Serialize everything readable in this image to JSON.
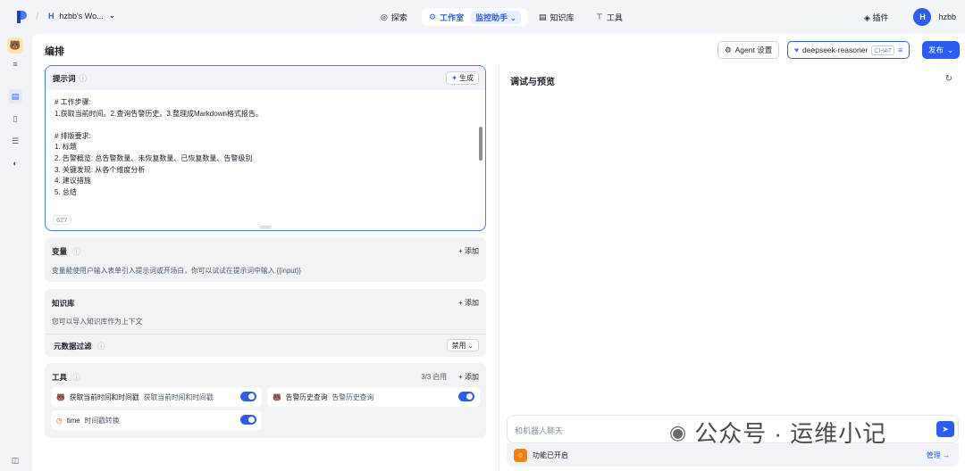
{
  "topbar": {
    "workspace_initial": "H",
    "workspace_name": "hzbb's Wo...",
    "nav": {
      "explore": "探索",
      "studio": "工作室",
      "agent_pill": "监控助手",
      "knowledge": "知识库",
      "tools": "工具"
    },
    "plugins": "插件",
    "user_initial": "H",
    "user_name": "hzbb"
  },
  "editor": {
    "title": "编排",
    "agent_settings": "Agent 设置",
    "model_name": "deepseek-reasoner",
    "model_tag": "CHAT",
    "publish": "发布"
  },
  "prompt": {
    "label": "提示词",
    "generate": "生成",
    "lines": [
      "# 工作步骤:",
      "1.获取当前时间。2.查询告警历史。3.整理成Markdown格式报告。",
      "",
      "# 排版要求:",
      "1. 标题",
      "2. 告警概览: 总告警数量、未恢复数量、已恢复数量、告警级别",
      "3. 关键发现: 从各个维度分析",
      "4. 建议措施",
      "5. 总结"
    ],
    "char_count": "627"
  },
  "variables": {
    "label": "变量",
    "add": "+ 添加",
    "desc": "变量能使用户输入表单引入提示词或开场白，你可以试试在提示词中输入 {{input}}"
  },
  "knowledge": {
    "label": "知识库",
    "add": "+ 添加",
    "desc": "您可以导入知识库作为上下文",
    "metadata_filter": "元数据过滤",
    "filter_value": "禁用"
  },
  "tools": {
    "label": "工具",
    "count": "3/3 启用",
    "add": "+ 添加",
    "items": [
      {
        "name": "获取当前时间和时间戳",
        "desc": "获取当前时间和时间戳",
        "enabled": true
      },
      {
        "name": "告警历史查询",
        "desc": "告警历史查询",
        "enabled": true
      },
      {
        "name": "time",
        "desc": "时间戳转换",
        "enabled": true
      }
    ]
  },
  "debug": {
    "title": "调试与预览",
    "chat_placeholder": "和机器人聊天",
    "feature_status": "功能已开启",
    "manage": "管理"
  },
  "watermark": "公众号 · 运维小记"
}
